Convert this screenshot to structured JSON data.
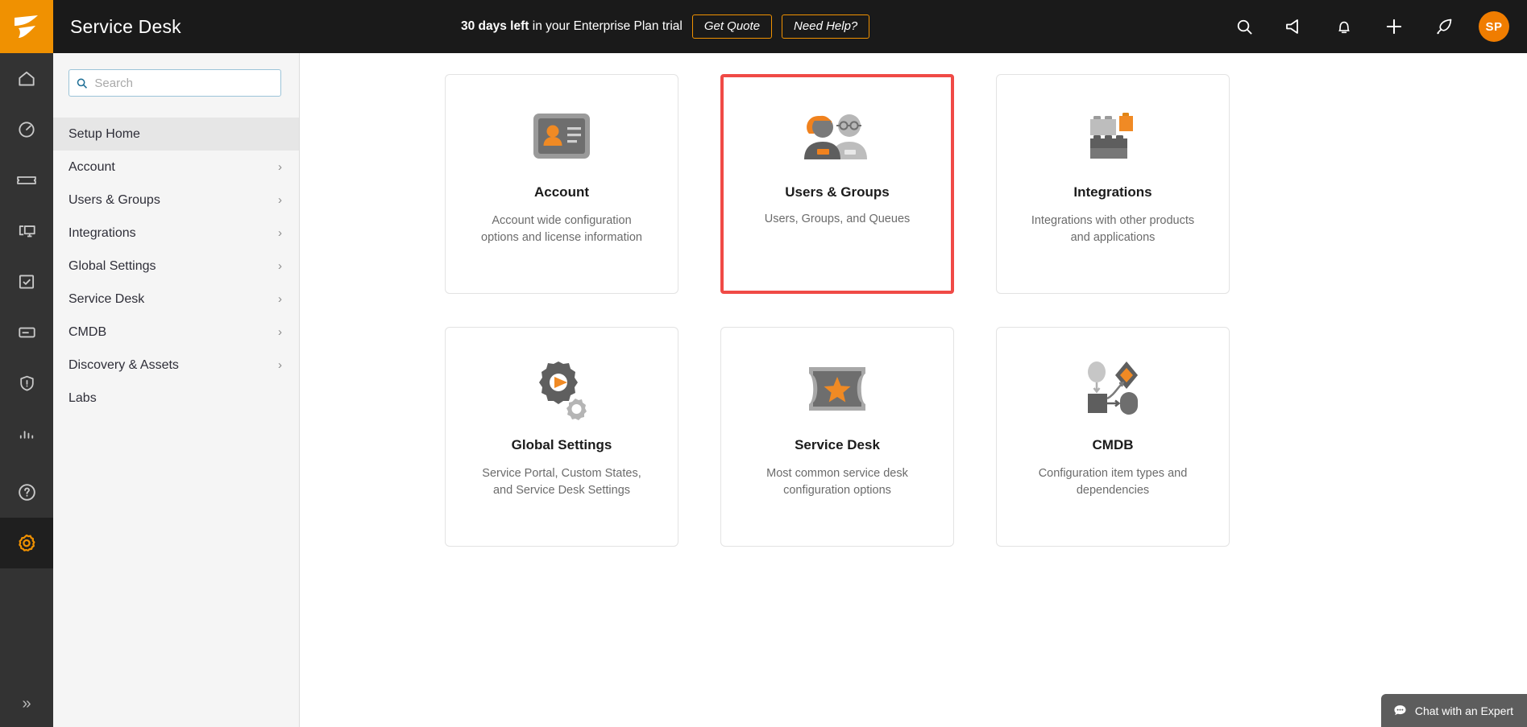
{
  "header": {
    "logo_icon": "solarwinds-logo-icon",
    "app_title": "Service Desk",
    "trial": {
      "days_bold": "30 days left",
      "rest": " in your Enterprise Plan trial",
      "get_quote_label": "Get Quote",
      "need_help_label": "Need Help?"
    },
    "actions": [
      {
        "name": "search-icon"
      },
      {
        "name": "announcement-icon"
      },
      {
        "name": "bell-icon"
      },
      {
        "name": "plus-icon"
      },
      {
        "name": "rocket-icon"
      }
    ],
    "avatar_initials": "SP"
  },
  "rail": {
    "items": [
      {
        "name": "home-icon"
      },
      {
        "name": "dashboard-gauge-icon"
      },
      {
        "name": "ticket-icon"
      },
      {
        "name": "devices-icon"
      },
      {
        "name": "tasks-checkbox-icon"
      },
      {
        "name": "card-icon"
      },
      {
        "name": "shield-alert-icon"
      },
      {
        "name": "reports-bars-icon"
      }
    ],
    "help_icon": "help-circle-icon",
    "settings_icon": "gear-icon",
    "expand_label": "»"
  },
  "sidebar": {
    "search": {
      "placeholder": "Search",
      "value": ""
    },
    "items": [
      {
        "label": "Setup Home",
        "active": true,
        "chevron": false
      },
      {
        "label": "Account",
        "active": false,
        "chevron": true
      },
      {
        "label": "Users & Groups",
        "active": false,
        "chevron": true
      },
      {
        "label": "Integrations",
        "active": false,
        "chevron": true
      },
      {
        "label": "Global Settings",
        "active": false,
        "chevron": true
      },
      {
        "label": "Service Desk",
        "active": false,
        "chevron": true
      },
      {
        "label": "CMDB",
        "active": false,
        "chevron": true
      },
      {
        "label": "Discovery & Assets",
        "active": false,
        "chevron": true
      },
      {
        "label": "Labs",
        "active": false,
        "chevron": false
      }
    ],
    "chevron_glyph": "›"
  },
  "main": {
    "cards": [
      {
        "title": "Account",
        "desc": "Account wide configuration options and license information",
        "icon": "id-card-icon",
        "highlighted": false
      },
      {
        "title": "Users & Groups",
        "desc": "Users, Groups, and Queues",
        "icon": "users-group-icon",
        "highlighted": true
      },
      {
        "title": "Integrations",
        "desc": "Integrations with other products and applications",
        "icon": "building-blocks-icon",
        "highlighted": false
      },
      {
        "title": "Global Settings",
        "desc": "Service Portal, Custom States, and Service Desk Settings",
        "icon": "gears-play-icon",
        "highlighted": false
      },
      {
        "title": "Service Desk",
        "desc": "Most common service desk configuration options",
        "icon": "ticket-star-icon",
        "highlighted": false
      },
      {
        "title": "CMDB",
        "desc": "Configuration item types and dependencies",
        "icon": "cmdb-nodes-icon",
        "highlighted": false
      }
    ]
  },
  "chat": {
    "label": "Chat with an Expert",
    "icon": "chat-bubble-icon"
  },
  "colors": {
    "brand_orange": "#f09101",
    "header_bg": "#1a1a1a",
    "rail_bg": "#333333",
    "sidebar_bg": "#f5f5f5",
    "highlight_red": "#f04a46",
    "avatar_orange": "#f07d00"
  }
}
